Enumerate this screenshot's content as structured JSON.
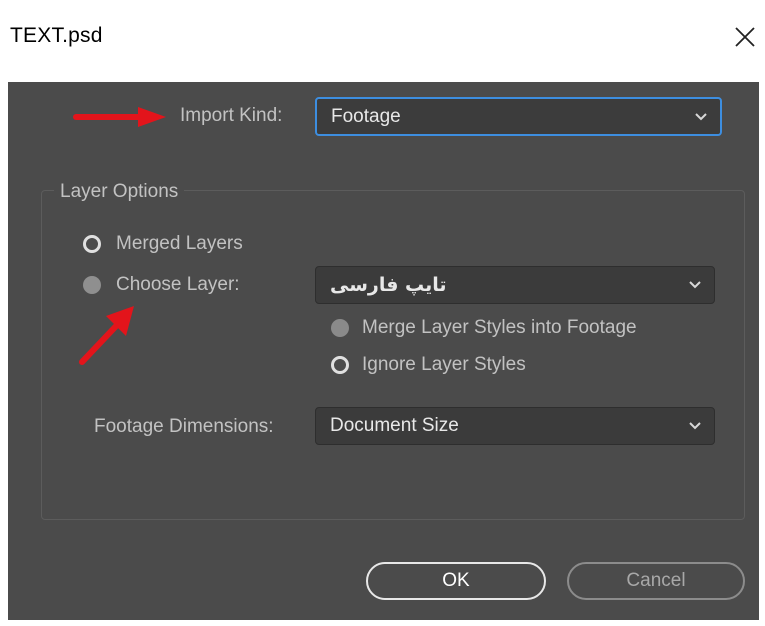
{
  "window": {
    "title": "TEXT.psd"
  },
  "import_kind": {
    "label": "Import Kind:",
    "value": "Footage"
  },
  "layer_options": {
    "title": "Layer Options",
    "merged_layers_label": "Merged Layers",
    "choose_layer_label": "Choose Layer:",
    "choose_layer_value": "تایپ فارسی",
    "merge_styles_label": "Merge Layer Styles into Footage",
    "ignore_styles_label": "Ignore Layer Styles",
    "footage_dimensions_label": "Footage Dimensions:",
    "footage_dimensions_value": "Document Size"
  },
  "buttons": {
    "ok": "OK",
    "cancel": "Cancel"
  },
  "colors": {
    "dialog_bg": "#4b4b4b",
    "focus_border": "#3d8ee0",
    "annotation_arrow": "#e3141b"
  },
  "icons": [
    "close-icon",
    "chevron-down-icon",
    "annotation-arrow"
  ]
}
